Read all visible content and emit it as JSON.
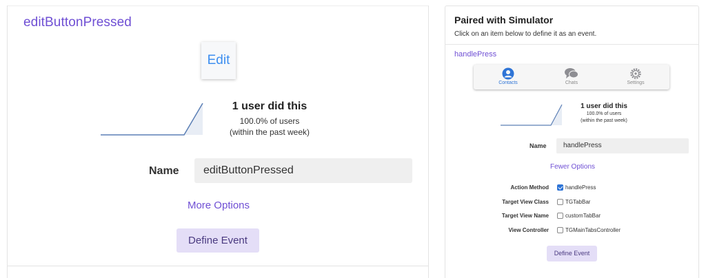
{
  "left": {
    "event_title": "editButtonPressed",
    "thumbnail_text": "Edit",
    "stats": {
      "headline": "1 user did this",
      "percent": "100.0% of users",
      "period": "(within the past week)"
    },
    "name_label": "Name",
    "name_value": "editButtonPressed",
    "more_options": "More Options",
    "define_button": "Define Event"
  },
  "right": {
    "title": "Paired with Simulator",
    "subtitle": "Click on an item below to define it as an event.",
    "event_title": "handlePress",
    "tabs": [
      {
        "label": "Contacts",
        "icon": "person-icon",
        "active": true
      },
      {
        "label": "Chats",
        "icon": "chat-bubbles-icon",
        "active": false
      },
      {
        "label": "Settings",
        "icon": "gear-icon",
        "active": false
      }
    ],
    "stats": {
      "headline": "1 user did this",
      "percent": "100.0% of users",
      "period": "(within the past week)"
    },
    "name_label": "Name",
    "name_value": "handlePress",
    "fewer_options": "Fewer Options",
    "options": [
      {
        "label": "Action Method",
        "value": "handlePress",
        "checked": true
      },
      {
        "label": "Target View Class",
        "value": "TGTabBar",
        "checked": false
      },
      {
        "label": "Target View Name",
        "value": "customTabBar",
        "checked": false
      },
      {
        "label": "View Controller",
        "value": "TGMainTabsController",
        "checked": false
      }
    ],
    "define_button": "Define Event"
  },
  "colors": {
    "accent_purple": "#6f4fd4",
    "button_bg": "#e4def7",
    "ios_blue": "#2e74d6",
    "sparkline": "#5b7fb5"
  }
}
